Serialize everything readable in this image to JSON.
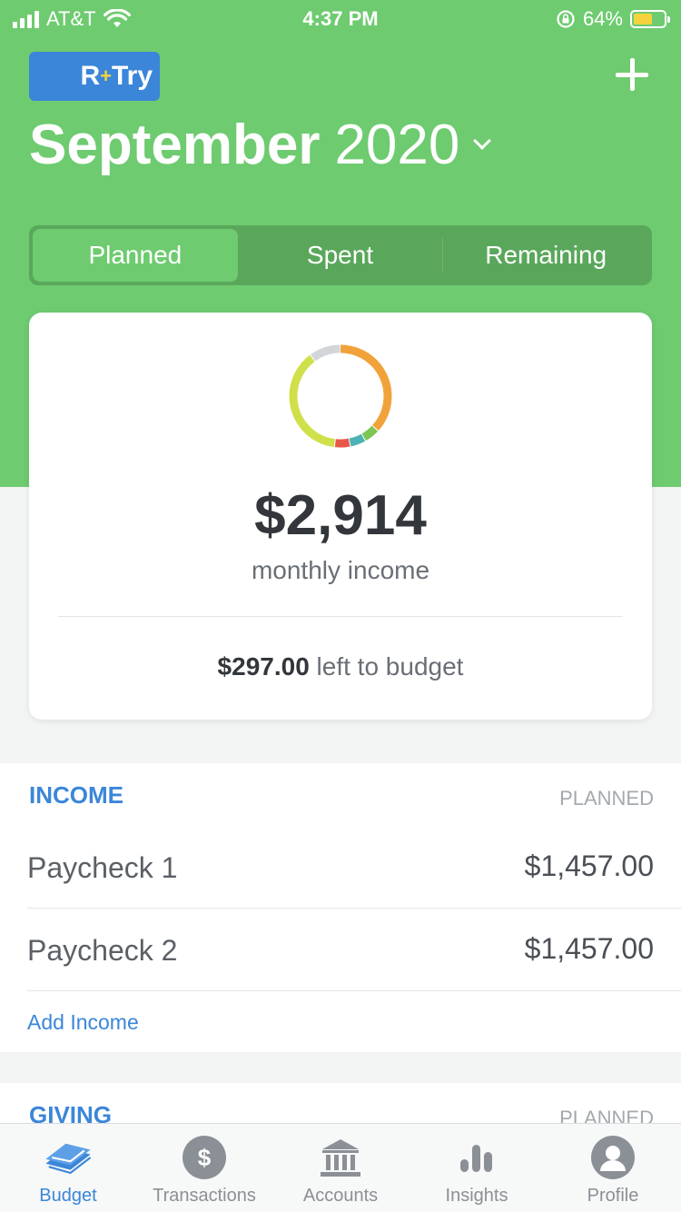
{
  "status_bar": {
    "carrier": "AT&T",
    "time": "4:37 PM",
    "battery": "64%"
  },
  "header": {
    "badge_prefix": "R",
    "badge_suffix": "Try",
    "month": "September",
    "year": "2020"
  },
  "tabs": [
    {
      "label": "Planned",
      "active": true
    },
    {
      "label": "Spent",
      "active": false
    },
    {
      "label": "Remaining",
      "active": false
    }
  ],
  "summary": {
    "amount": "$2,914",
    "label": "monthly income",
    "left_amount": "$297.00",
    "left_label": " left to budget"
  },
  "donut": {
    "segments": [
      {
        "fraction": 0.37,
        "color": "#f1a23a"
      },
      {
        "fraction": 0.05,
        "color": "#7cc655"
      },
      {
        "fraction": 0.05,
        "color": "#4bb3b5"
      },
      {
        "fraction": 0.05,
        "color": "#e8584a"
      },
      {
        "fraction": 0.38,
        "color": "#cfe04a"
      },
      {
        "fraction": 0.1,
        "color": "#d3d6d9"
      }
    ]
  },
  "income": {
    "title": "INCOME",
    "column": "PLANNED",
    "items": [
      {
        "name": "Paycheck 1",
        "amount": "$1,457.00"
      },
      {
        "name": "Paycheck 2",
        "amount": "$1,457.00"
      }
    ],
    "add_label": "Add Income"
  },
  "giving": {
    "title": "GIVING",
    "column": "PLANNED"
  },
  "tab_bar": [
    {
      "label": "Budget",
      "active": true
    },
    {
      "label": "Transactions",
      "active": false
    },
    {
      "label": "Accounts",
      "active": false
    },
    {
      "label": "Insights",
      "active": false
    },
    {
      "label": "Profile",
      "active": false
    }
  ],
  "colors": {
    "brand_green": "#6ecb70",
    "accent_blue": "#3b86d9"
  }
}
